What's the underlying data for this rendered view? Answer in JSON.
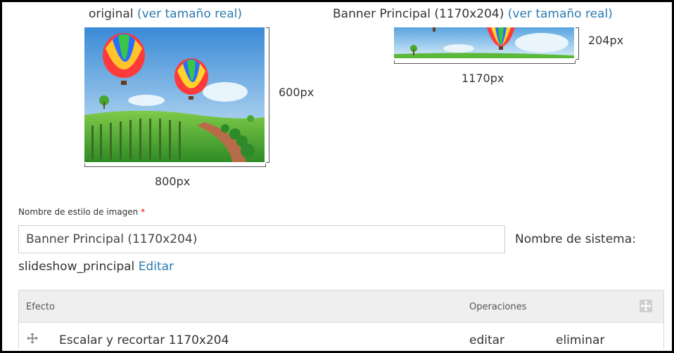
{
  "preview": {
    "original": {
      "caption": "original",
      "link": "(ver tamaño real)",
      "height_label": "600px",
      "width_label": "800px"
    },
    "styled": {
      "caption": "Banner Principal (1170x204)",
      "link": "(ver tamaño real)",
      "height_label": "204px",
      "width_label": "1170px"
    }
  },
  "form": {
    "name_label": "Nombre de estilo de imagen",
    "required_mark": "*",
    "name_value": "Banner Principal (1170x204)",
    "machine_label": "Nombre de sistema:",
    "machine_value": "slideshow_principal",
    "machine_edit": "Editar"
  },
  "effects_table": {
    "headers": {
      "effect": "Efecto",
      "operations": "Operaciones"
    },
    "rows": [
      {
        "effect": "Escalar y recortar 1170x204",
        "edit": "editar",
        "delete": "eliminar"
      }
    ]
  },
  "colors": {
    "link": "#2a7ab0",
    "required": "#e00000",
    "header_bg": "#efefef"
  }
}
